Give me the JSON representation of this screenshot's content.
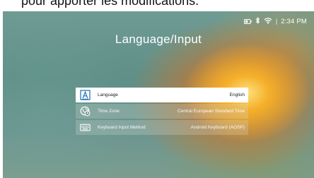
{
  "caption": {
    "text": "pour apporter les modifications."
  },
  "status_bar": {
    "icons": [
      "battery-icon",
      "bluetooth-icon",
      "wifi-icon"
    ],
    "separator": "|",
    "time": "2:34 PM"
  },
  "page": {
    "title": "Language/Input"
  },
  "menu": {
    "items": [
      {
        "label": "Language",
        "value": "English",
        "icon": "language-icon",
        "selected": true
      },
      {
        "label": "Time Zone",
        "value": "Central European Standard Time",
        "icon": "globe-clock-icon",
        "selected": false
      },
      {
        "label": "Keyboard Input Method",
        "value": "Android Keyboard (AOSP)",
        "icon": "keyboard-icon",
        "selected": false
      }
    ]
  },
  "colors": {
    "selection_background": "#ffffff",
    "accent_blue": "#1f6fb5",
    "background_teal": "#6f9b93",
    "flower_orange": "#f39a24"
  }
}
